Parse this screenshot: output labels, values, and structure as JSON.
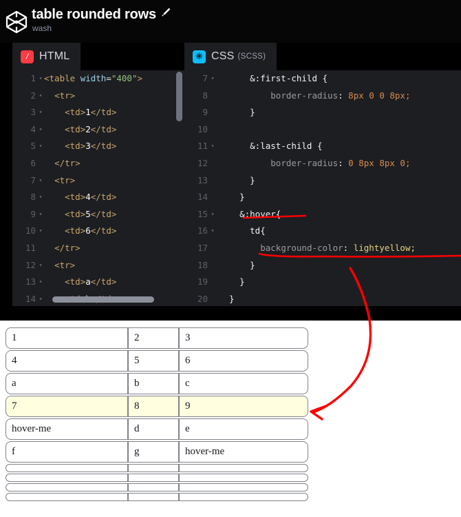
{
  "header": {
    "logo_icon": "codepen-logo-icon",
    "title": "table rounded rows",
    "edit_icon": "pencil-icon",
    "author": "wash"
  },
  "editors": {
    "html_pane": {
      "tab_label": "HTML",
      "tab_icon": "html-logo-icon",
      "tab_icon_glyph": "/",
      "lines": [
        {
          "n": "1",
          "fold": "▾",
          "code": "<table width=\"400\">"
        },
        {
          "n": "2",
          "fold": "▾",
          "code": "  <tr>"
        },
        {
          "n": "3",
          "fold": "▾",
          "code": "    <td>1</td>"
        },
        {
          "n": "4",
          "fold": "▾",
          "code": "    <td>2</td>"
        },
        {
          "n": "5",
          "fold": "▾",
          "code": "    <td>3</td>"
        },
        {
          "n": "6",
          "fold": "",
          "code": "  </tr>"
        },
        {
          "n": "7",
          "fold": "▾",
          "code": "  <tr>"
        },
        {
          "n": "8",
          "fold": "▾",
          "code": "    <td>4</td>"
        },
        {
          "n": "9",
          "fold": "▾",
          "code": "    <td>5</td>"
        },
        {
          "n": "10",
          "fold": "▾",
          "code": "    <td>6</td>"
        },
        {
          "n": "11",
          "fold": "",
          "code": "  </tr>"
        },
        {
          "n": "12",
          "fold": "▾",
          "code": "  <tr>"
        },
        {
          "n": "13",
          "fold": "▾",
          "code": "    <td>a</td>"
        },
        {
          "n": "14",
          "fold": "▾",
          "code": "    <td>b</td>"
        }
      ]
    },
    "css_pane": {
      "tab_label": "CSS",
      "tab_sublabel": "(SCSS)",
      "tab_icon": "css-logo-icon",
      "tab_icon_glyph": "✳",
      "lines": [
        {
          "n": "7",
          "fold": "▾",
          "code": "      &:first-child {"
        },
        {
          "n": "8",
          "fold": "",
          "code": "          border-radius: 8px 0 0 8px;"
        },
        {
          "n": "9",
          "fold": "",
          "code": "      }"
        },
        {
          "n": "10",
          "fold": "",
          "code": ""
        },
        {
          "n": "11",
          "fold": "▾",
          "code": "      &:last-child {"
        },
        {
          "n": "12",
          "fold": "",
          "code": "          border-radius: 0 8px 8px 0;"
        },
        {
          "n": "13",
          "fold": "",
          "code": "      }"
        },
        {
          "n": "14",
          "fold": "",
          "code": "    }"
        },
        {
          "n": "15",
          "fold": "▾",
          "code": "    &:hover{"
        },
        {
          "n": "16",
          "fold": "▾",
          "code": "      td{"
        },
        {
          "n": "17",
          "fold": "",
          "code": "        background-color: lightyellow;"
        },
        {
          "n": "18",
          "fold": "",
          "code": "      }"
        },
        {
          "n": "19",
          "fold": "",
          "code": "    }"
        },
        {
          "n": "20",
          "fold": "",
          "code": "  }"
        }
      ]
    }
  },
  "preview": {
    "rows": [
      {
        "cells": [
          "1",
          "2",
          "3"
        ],
        "hovered": false
      },
      {
        "cells": [
          "4",
          "5",
          "6"
        ],
        "hovered": false
      },
      {
        "cells": [
          "a",
          "b",
          "c"
        ],
        "hovered": false
      },
      {
        "cells": [
          "7",
          "8",
          "9"
        ],
        "hovered": true
      },
      {
        "cells": [
          "hover-me",
          "d",
          "e"
        ],
        "hovered": false
      },
      {
        "cells": [
          "f",
          "g",
          "hover-me"
        ],
        "hovered": false
      },
      {
        "cells": [
          "",
          "",
          ""
        ],
        "hovered": false
      },
      {
        "cells": [
          "",
          "",
          ""
        ],
        "hovered": false
      },
      {
        "cells": [
          "",
          "",
          ""
        ],
        "hovered": false
      },
      {
        "cells": [
          "",
          "",
          ""
        ],
        "hovered": false
      }
    ]
  },
  "annotations": {
    "color": "#ff0000",
    "underline_hover_selector": "&:hover{",
    "underline_background_color": "background-color: lightyellow;",
    "arrow": "arrow pointing to highlighted row"
  },
  "colors": {
    "accent_html": "#ff3c41",
    "accent_css": "#0ebeff",
    "editor_bg": "#1d1e22",
    "page_bg": "#000000",
    "highlight": "#ffffe0",
    "annotation": "#ff0000"
  }
}
